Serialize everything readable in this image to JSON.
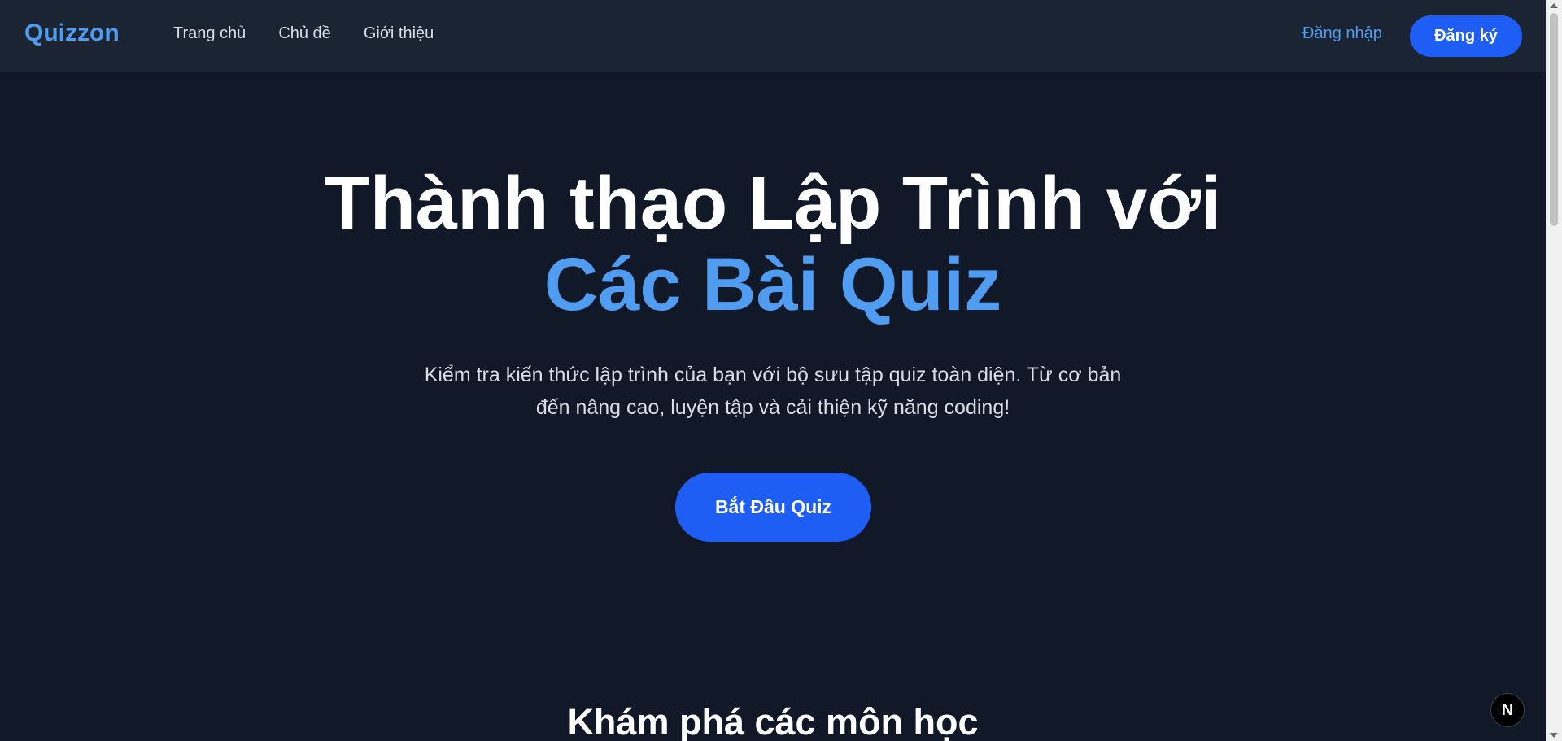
{
  "header": {
    "logo": "Quizzon",
    "nav": [
      {
        "label": "Trang chủ"
      },
      {
        "label": "Chủ đề"
      },
      {
        "label": "Giới thiệu"
      }
    ],
    "login_label": "Đăng nhập",
    "signup_label": "Đăng ký"
  },
  "hero": {
    "title_line1": "Thành thạo Lập Trình với",
    "title_line2": "Các Bài Quiz",
    "subtitle": "Kiểm tra kiến thức lập trình của bạn với bộ sưu tập quiz toàn diện. Từ cơ bản đến nâng cao, luyện tập và cải thiện kỹ năng coding!",
    "cta_label": "Bắt Đầu Quiz"
  },
  "sections": {
    "explore_title": "Khám phá các môn học"
  },
  "badge": {
    "letter": "N"
  },
  "colors": {
    "background": "#111827",
    "header_bg": "#1b2433",
    "accent": "#4f9cf0",
    "primary_button": "#1e5ef5"
  }
}
